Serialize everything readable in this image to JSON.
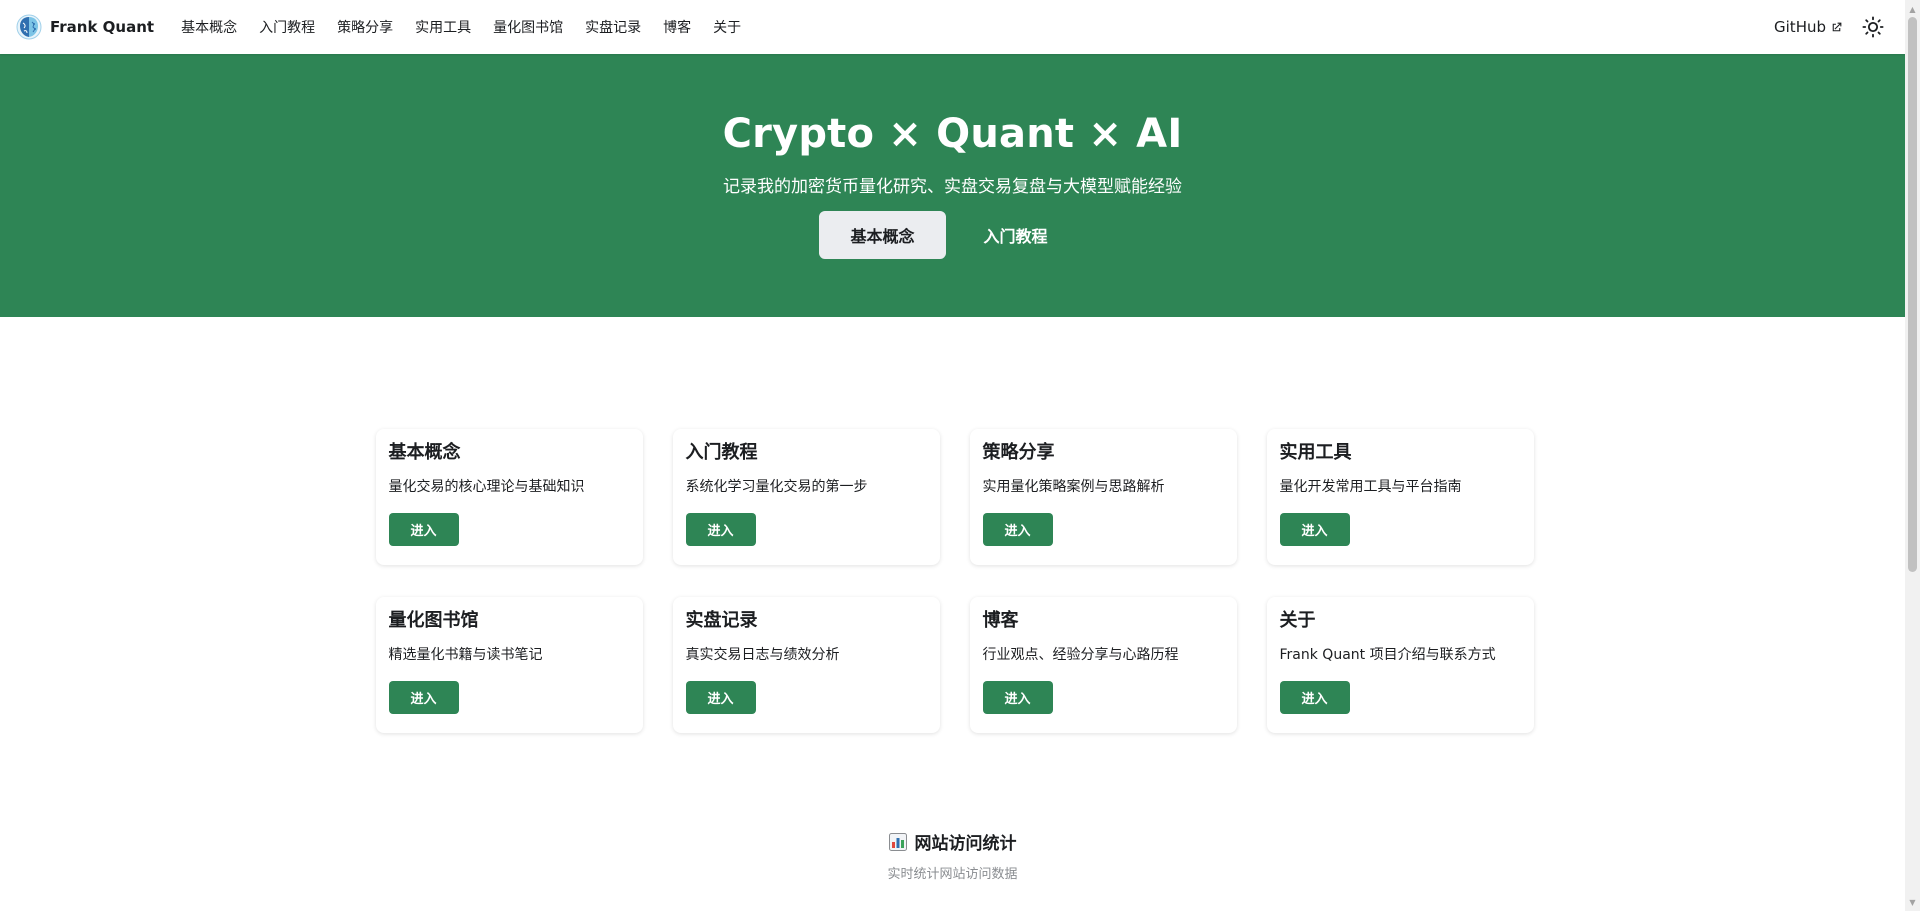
{
  "navbar": {
    "brand": "Frank Quant",
    "items": [
      {
        "label": "基本概念"
      },
      {
        "label": "入门教程"
      },
      {
        "label": "策略分享"
      },
      {
        "label": "实用工具"
      },
      {
        "label": "量化图书馆"
      },
      {
        "label": "实盘记录"
      },
      {
        "label": "博客"
      },
      {
        "label": "关于"
      }
    ],
    "github": "GitHub",
    "icons": {
      "logo": "brain-logo-icon",
      "external": "external-link-icon",
      "theme": "sun-icon"
    }
  },
  "hero": {
    "title": "Crypto × Quant × AI",
    "subtitle": "记录我的加密货币量化研究、实盘交易复盘与大模型赋能经验",
    "primary_button": "基本概念",
    "secondary_button": "入门教程"
  },
  "cards": [
    {
      "title": "基本概念",
      "desc": "量化交易的核心理论与基础知识",
      "button": "进入"
    },
    {
      "title": "入门教程",
      "desc": "系统化学习量化交易的第一步",
      "button": "进入"
    },
    {
      "title": "策略分享",
      "desc": "实用量化策略案例与思路解析",
      "button": "进入"
    },
    {
      "title": "实用工具",
      "desc": "量化开发常用工具与平台指南",
      "button": "进入"
    },
    {
      "title": "量化图书馆",
      "desc": "精选量化书籍与读书笔记",
      "button": "进入"
    },
    {
      "title": "实盘记录",
      "desc": "真实交易日志与绩效分析",
      "button": "进入"
    },
    {
      "title": "博客",
      "desc": "行业观点、经验分享与心路历程",
      "button": "进入"
    },
    {
      "title": "关于",
      "desc": "Frank Quant 项目介绍与联系方式",
      "button": "进入"
    }
  ],
  "stats": {
    "title": "网站访问统计",
    "subtitle": "实时统计网站访问数据",
    "icon": "bar-chart-icon"
  },
  "colors": {
    "primary": "#2e8555",
    "secondary_button_bg": "#ebedf0",
    "text": "#1c1e21",
    "muted": "#8a8d91"
  }
}
